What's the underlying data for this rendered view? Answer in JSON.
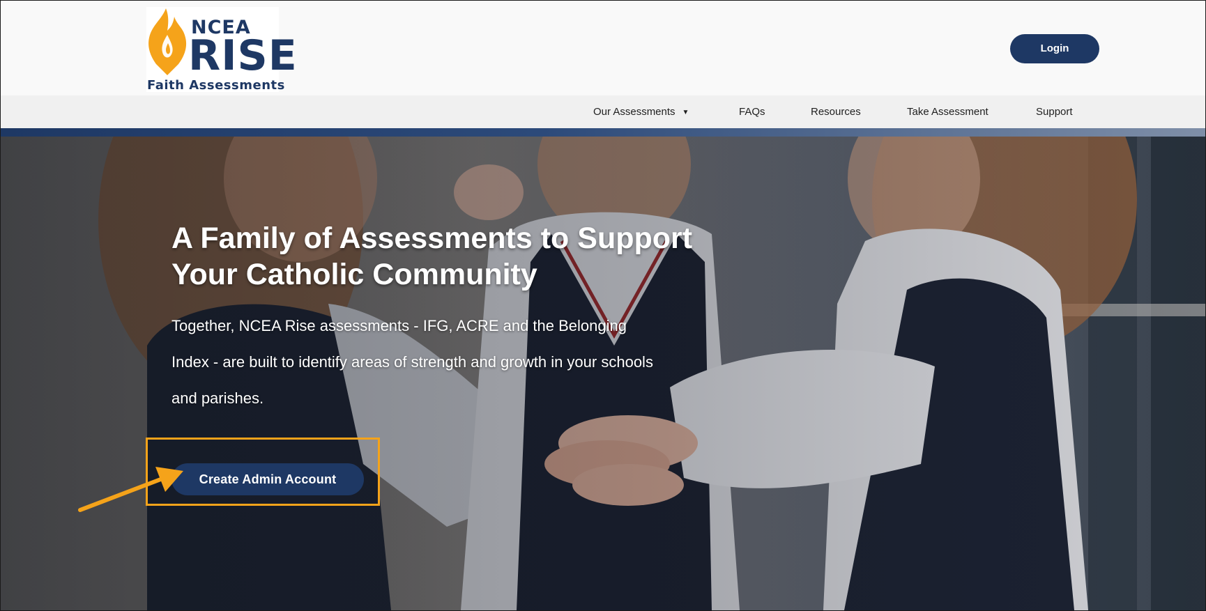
{
  "logo": {
    "line1": "NCEA",
    "line2": "RISE",
    "line3": "Faith Assessments"
  },
  "header": {
    "login_label": "Login"
  },
  "nav": {
    "items": [
      {
        "label": "Our Assessments",
        "has_dropdown": true,
        "caret": "▼"
      },
      {
        "label": "FAQs",
        "has_dropdown": false
      },
      {
        "label": "Resources",
        "has_dropdown": false
      },
      {
        "label": "Take Assessment",
        "has_dropdown": false
      },
      {
        "label": "Support",
        "has_dropdown": false
      }
    ]
  },
  "hero": {
    "title": "A Family of Assessments to Support Your Catholic Community",
    "body": "Together, NCEA Rise assessments - IFG, ACRE and the Belonging Index - are built to identify areas of strength and growth in your schools and parishes.",
    "cta_label": "Create Admin Account"
  },
  "colors": {
    "brand_navy": "#1e3864",
    "brand_orange": "#f5a31a",
    "nav_background": "#f0f0f0",
    "header_background": "#f9f9f9"
  },
  "icons": {
    "logo_mark": "flame-icon",
    "nav_dropdown": "caret-down-icon",
    "annotation": "arrow-icon"
  }
}
